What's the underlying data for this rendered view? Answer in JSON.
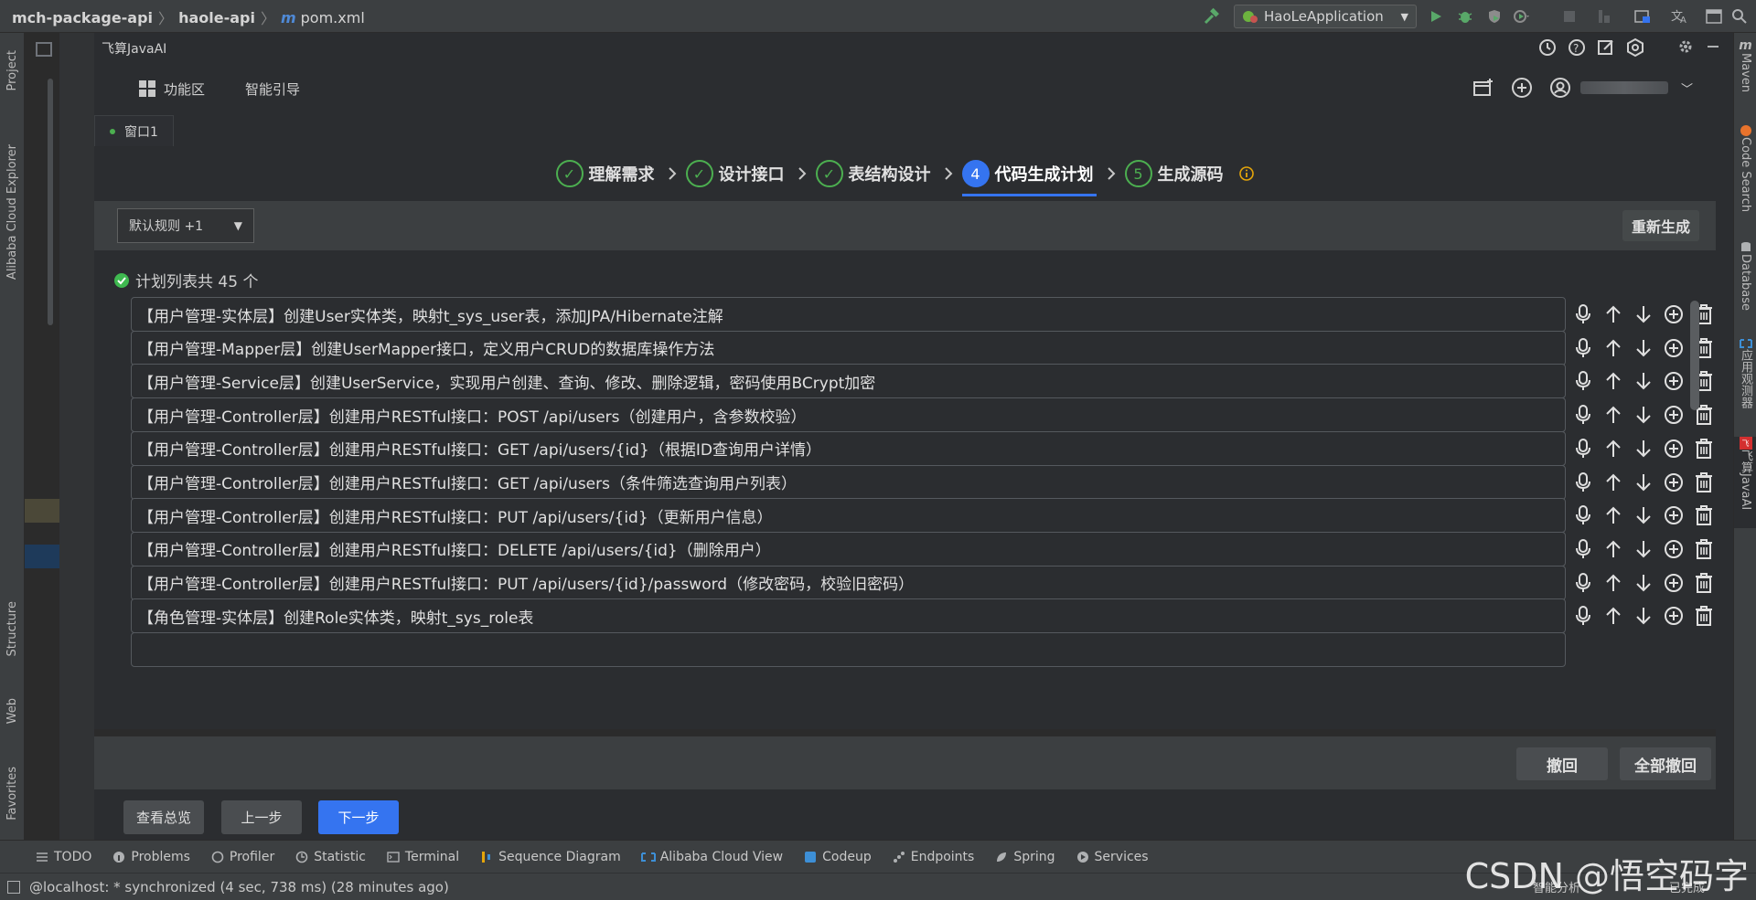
{
  "titlebar": {
    "breadcrumb": [
      "mch-package-api",
      "haole-api",
      "pom.xml"
    ],
    "run_config": "HaoLeApplication"
  },
  "left_strip": {
    "tabs": [
      "Project",
      "Alibaba Cloud Explorer",
      "Structure",
      "Web",
      "Favorites"
    ]
  },
  "right_strip": {
    "tabs": [
      "Maven",
      "Code Search",
      "Database",
      "应用观测器",
      "飞算JavaAI"
    ]
  },
  "plugin": {
    "title": "飞算JavaAI",
    "func_area": "功能区",
    "smart_guide": "智能引导",
    "window_tab": "窗口1"
  },
  "steps": [
    {
      "num": "✓",
      "label": "理解需求",
      "state": "done"
    },
    {
      "num": "✓",
      "label": "设计接口",
      "state": "done"
    },
    {
      "num": "✓",
      "label": "表结构设计",
      "state": "done"
    },
    {
      "num": "4",
      "label": "代码生成计划",
      "state": "active"
    },
    {
      "num": "5",
      "label": "生成源码",
      "state": "pending"
    }
  ],
  "rules": {
    "select_value": "默认规则 +1",
    "regenerate": "重新生成"
  },
  "plan": {
    "summary": "计划列表共 45 个",
    "items": [
      "【用户管理-实体层】创建User实体类，映射t_sys_user表，添加JPA/Hibernate注解",
      "【用户管理-Mapper层】创建UserMapper接口，定义用户CRUD的数据库操作方法",
      "【用户管理-Service层】创建UserService，实现用户创建、查询、修改、删除逻辑，密码使用BCrypt加密",
      "【用户管理-Controller层】创建用户RESTful接口：POST /api/users（创建用户，含参数校验）",
      "【用户管理-Controller层】创建用户RESTful接口：GET /api/users/{id}（根据ID查询用户详情）",
      "【用户管理-Controller层】创建用户RESTful接口：GET /api/users（条件筛选查询用户列表）",
      "【用户管理-Controller层】创建用户RESTful接口：PUT /api/users/{id}（更新用户信息）",
      "【用户管理-Controller层】创建用户RESTful接口：DELETE /api/users/{id}（删除用户）",
      "【用户管理-Controller层】创建用户RESTful接口：PUT /api/users/{id}/password（修改密码，校验旧密码）",
      "【角色管理-实体层】创建Role实体类，映射t_sys_role表"
    ]
  },
  "undo": {
    "undo": "撤回",
    "undo_all": "全部撤回"
  },
  "nav": {
    "overview": "查看总览",
    "prev": "上一步",
    "next": "下一步"
  },
  "bottom_tabs": [
    "TODO",
    "Problems",
    "Profiler",
    "Statistic",
    "Terminal",
    "Sequence Diagram",
    "Alibaba Cloud View",
    "Codeup",
    "Endpoints",
    "Spring",
    "Services"
  ],
  "status": {
    "message": "@localhost: * synchronized (4 sec, 738 ms) (28 minutes ago)",
    "right_ai": "智能分析",
    "right_done": "已完成"
  },
  "watermark": "CSDN @悟空码字",
  "colors": {
    "accent": "#3574f0",
    "done_green": "#4caf50",
    "summary_green": "#3fb950"
  }
}
